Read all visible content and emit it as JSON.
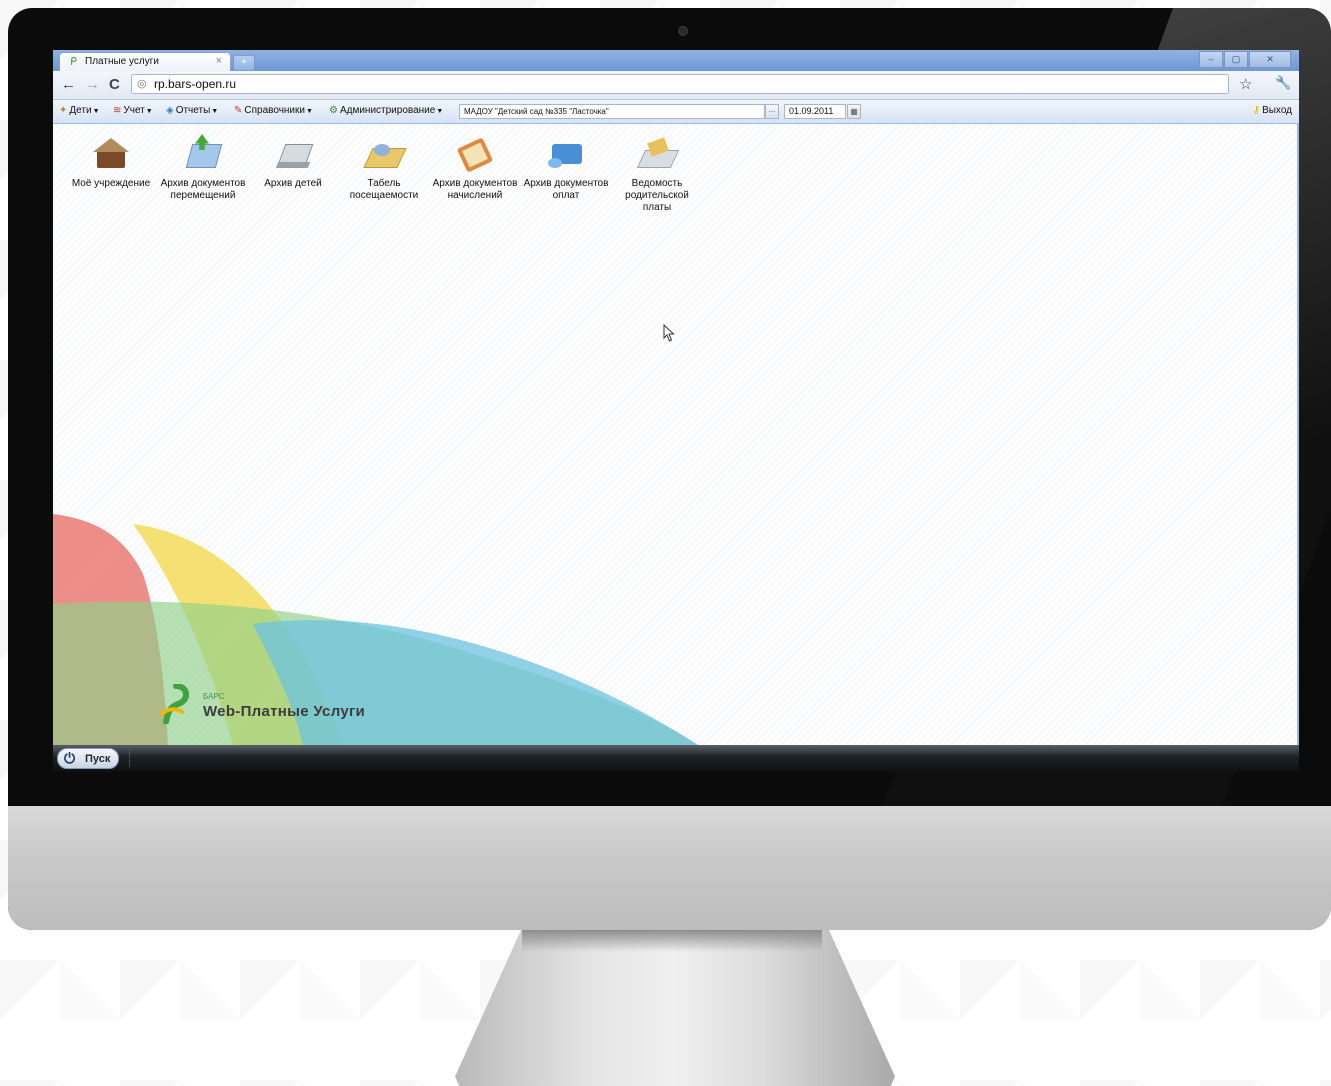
{
  "browser": {
    "tab_title": "Платные услуги",
    "tab_close": "×",
    "new_tab": "+",
    "url": "rp.bars-open.ru",
    "window_buttons": [
      "–",
      "▢",
      "✕"
    ]
  },
  "menu": {
    "items": [
      {
        "label": "Дети",
        "icon": "children-icon"
      },
      {
        "label": "Учет",
        "icon": "accounting-icon"
      },
      {
        "label": "Отчеты",
        "icon": "reports-icon"
      },
      {
        "label": "Справочники",
        "icon": "directories-icon"
      },
      {
        "label": "Администрирование",
        "icon": "admin-icon"
      }
    ],
    "organization": "МАДОУ \"Детский сад №335 \"Ласточка\"",
    "organization_trigger": "...",
    "date": "01.09.2011",
    "logout": "Выход"
  },
  "shortcuts": [
    {
      "label": "Моё учреждение",
      "icon": "institution-icon"
    },
    {
      "label": "Архив документов перемещений",
      "icon": "transfer-archive-icon"
    },
    {
      "label": "Архив детей",
      "icon": "children-archive-icon"
    },
    {
      "label": "Табель посещаемости",
      "icon": "attendance-icon"
    },
    {
      "label": "Архив документов начислений",
      "icon": "charges-archive-icon"
    },
    {
      "label": "Архив документов оплат",
      "icon": "payments-archive-icon"
    },
    {
      "label": "Ведомость родительской платы",
      "icon": "parent-fee-icon"
    }
  ],
  "brand": {
    "small": "БАРС",
    "name": "Web-Платные Услуги"
  },
  "taskbar": {
    "start_label": "Пуск"
  },
  "colors": {
    "accent_blue": "#99bbe8",
    "swoosh_red": "#e8736a",
    "swoosh_yellow": "#f3dc5a",
    "swoosh_green": "#8fd08a",
    "swoosh_cyan": "#6ec3e0"
  }
}
